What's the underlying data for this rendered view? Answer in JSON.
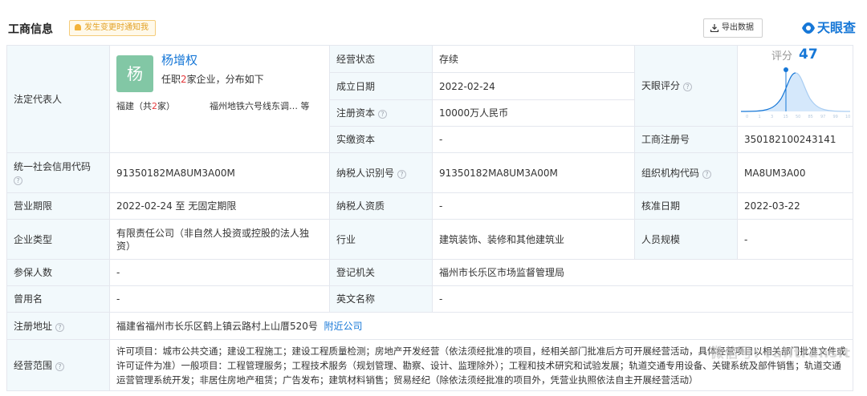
{
  "header": {
    "title": "工商信息",
    "notify_label": "发生变更时通知我",
    "export_label": "导出数据",
    "logo_text": "天眼查"
  },
  "rows": {
    "legal_rep_label": "法定代表人",
    "legal_rep_name": "杨增权",
    "legal_rep_avatar_char": "杨",
    "legal_rep_positions_prefix": "任职",
    "legal_rep_positions_count": "2",
    "legal_rep_positions_suffix": "家企业，分布如下",
    "legal_rep_region_prefix": "福建（共",
    "legal_rep_region_count": "2",
    "legal_rep_region_suffix": "家）",
    "legal_rep_project": "福州地铁六号线东调…  等",
    "status_label": "经营状态",
    "status_value": "存续",
    "founded_label": "成立日期",
    "founded_value": "2022-02-24",
    "reg_capital_label": "注册资本",
    "reg_capital_value": "10000万人民币",
    "paid_capital_label": "实缴资本",
    "paid_capital_value": "-",
    "tyscore_label": "天眼评分",
    "score_label": "评分",
    "score_value": "47",
    "score_ticks": [
      "0",
      "1",
      "3",
      "15",
      "50",
      "85",
      "97",
      "99",
      "100"
    ],
    "reg_no_label": "工商注册号",
    "reg_no_value": "350182100243141",
    "credit_code_label": "统一社会信用代码",
    "credit_code_value": "91350182MA8UM3A00M",
    "taxpayer_id_label": "纳税人识别号",
    "taxpayer_id_value": "91350182MA8UM3A00M",
    "org_code_label": "组织机构代码",
    "org_code_value": "MA8UM3A00",
    "term_label": "营业期限",
    "term_value": "2022-02-24 至 无固定期限",
    "taxpayer_qual_label": "纳税人资质",
    "taxpayer_qual_value": "-",
    "approve_date_label": "核准日期",
    "approve_date_value": "2022-03-22",
    "type_label": "企业类型",
    "type_value": "有限责任公司（非自然人投资或控股的法人独资）",
    "industry_label": "行业",
    "industry_value": "建筑装饰、装修和其他建筑业",
    "staff_label": "人员规模",
    "staff_value": "-",
    "insured_label": "参保人数",
    "insured_value": "-",
    "authority_label": "登记机关",
    "authority_value": "福州市长乐区市场监督管理局",
    "former_name_label": "曾用名",
    "former_name_value": "-",
    "en_name_label": "英文名称",
    "en_name_value": "-",
    "address_label": "注册地址",
    "address_value": "福建省福州市长乐区鹤上镇云路村上山厝520号",
    "address_link": "附近公司",
    "scope_label": "经营范围",
    "scope_value": "许可项目：城市公共交通；建设工程施工；建设工程质量检测；房地产开发经营（依法须经批准的项目，经相关部门批准后方可开展经营活动，具体经营项目以相关部门批准文件或许可证件为准）一般项目：工程管理服务；工程技术服务（规划管理、勘察、设计、监理除外）；工程和技术研究和试验发展；轨道交通专用设备、关键系统及部件销售；轨道交通运营管理系统开发；非居住房地产租赁；广告发布；建筑材料销售；贸易经纪（除依法须经批准的项目外，凭营业执照依法自主开展经营活动）"
  },
  "watermark": "微信号: railtransit",
  "colors": {
    "accent": "#1677d7",
    "label_bg": "#f2f9fc",
    "border": "#e4e7ee",
    "avatar": "#82c7a5",
    "warn": "#e2a125",
    "red": "#e4393c"
  }
}
